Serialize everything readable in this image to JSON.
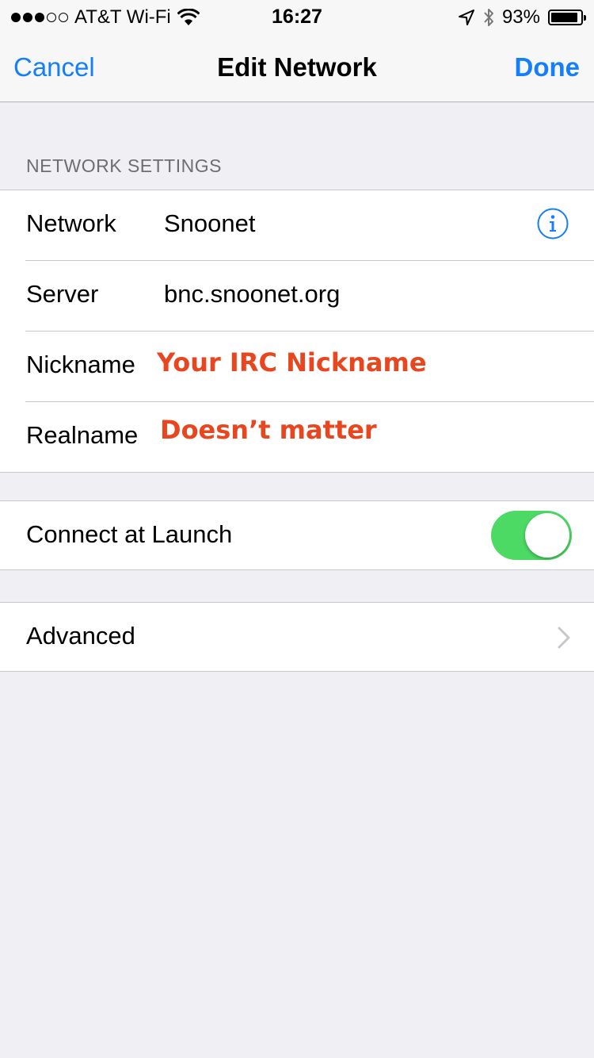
{
  "status_bar": {
    "carrier": "AT&T Wi-Fi",
    "time": "16:27",
    "battery": "93%",
    "battery_level": 0.93,
    "signal_bars_filled": 3,
    "signal_bars_total": 5
  },
  "nav": {
    "cancel_label": "Cancel",
    "title": "Edit Network",
    "done_label": "Done"
  },
  "network_settings": {
    "header": "NETWORK SETTINGS",
    "rows": [
      {
        "label": "Network",
        "value": "Snoonet",
        "icon": "info-icon"
      },
      {
        "label": "Server",
        "value": "bnc.snoonet.org"
      },
      {
        "label": "Nickname",
        "value": "",
        "overlay": "Your IRC Nickname"
      },
      {
        "label": "Realname",
        "value": "",
        "overlay": "Doesn’t matter"
      }
    ]
  },
  "connect": {
    "label": "Connect at Launch",
    "enabled": true
  },
  "advanced": {
    "label": "Advanced",
    "icon": "chevron-right-icon"
  },
  "colors": {
    "accent": "#147efb",
    "toggle_on": "#4cd964",
    "annotation": "#e8461f",
    "background": "#efeff4"
  }
}
